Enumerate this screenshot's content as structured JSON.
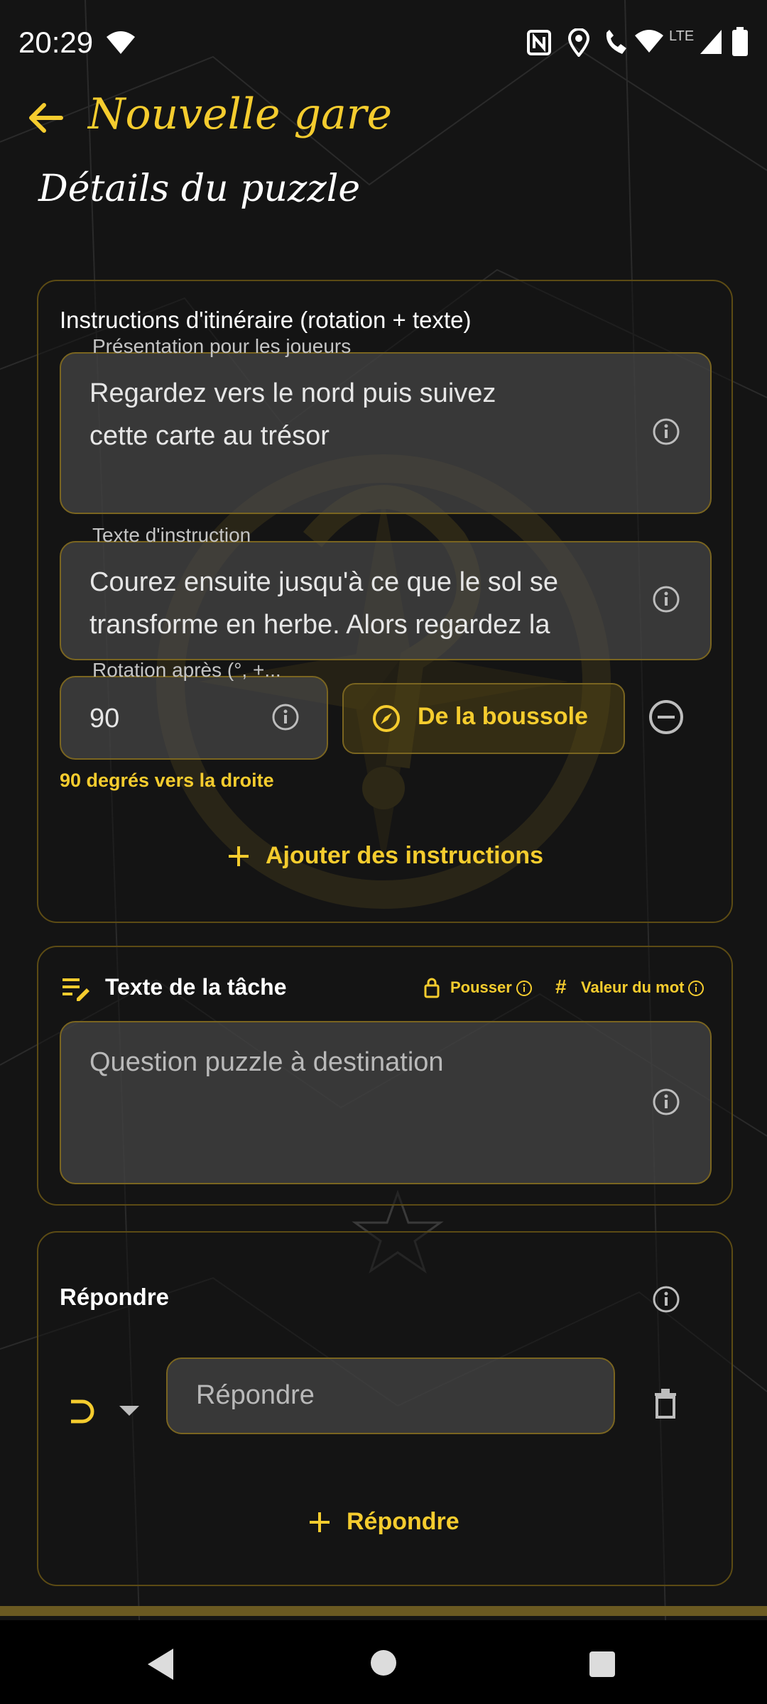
{
  "status_bar": {
    "time": "20:29",
    "network": "LTE",
    "icons": [
      "wifi-icon",
      "nfc-icon",
      "location-icon",
      "wifi-calling-icon",
      "wifi-icon",
      "signal-icon",
      "battery-icon"
    ]
  },
  "app_bar": {
    "title": "Nouvelle gare",
    "back_icon": "arrow-left-icon"
  },
  "page": {
    "title": "Détails du puzzle"
  },
  "route_card": {
    "title": "Instructions d'itinéraire (rotation + texte)",
    "presentation": {
      "label": "Présentation pour les joueurs",
      "value": "Regardez vers le nord puis suivez\ncette carte au trésor"
    },
    "instruction": {
      "label": "Texte d'instruction",
      "value": "Courez ensuite jusqu'à ce que le sol se\ntransforme en herbe. Alors regardez la"
    },
    "rotation": {
      "label": "Rotation après (°, +...",
      "value": "90",
      "helper": "90 degrés vers la droite"
    },
    "compass_button": "De la boussole",
    "add_instructions": "Ajouter des instructions"
  },
  "task_card": {
    "title": "Texte de la tâche",
    "push_label": "Pousser",
    "word_value_label": "Valeur du mot",
    "question_placeholder": "Question puzzle à destination"
  },
  "answer_card": {
    "title": "Répondre",
    "answer_placeholder": "Répondre",
    "add_answer": "Répondre"
  },
  "theme": {
    "accent": "#F5CC2E",
    "background": "#121212",
    "border": "#7a6520"
  }
}
